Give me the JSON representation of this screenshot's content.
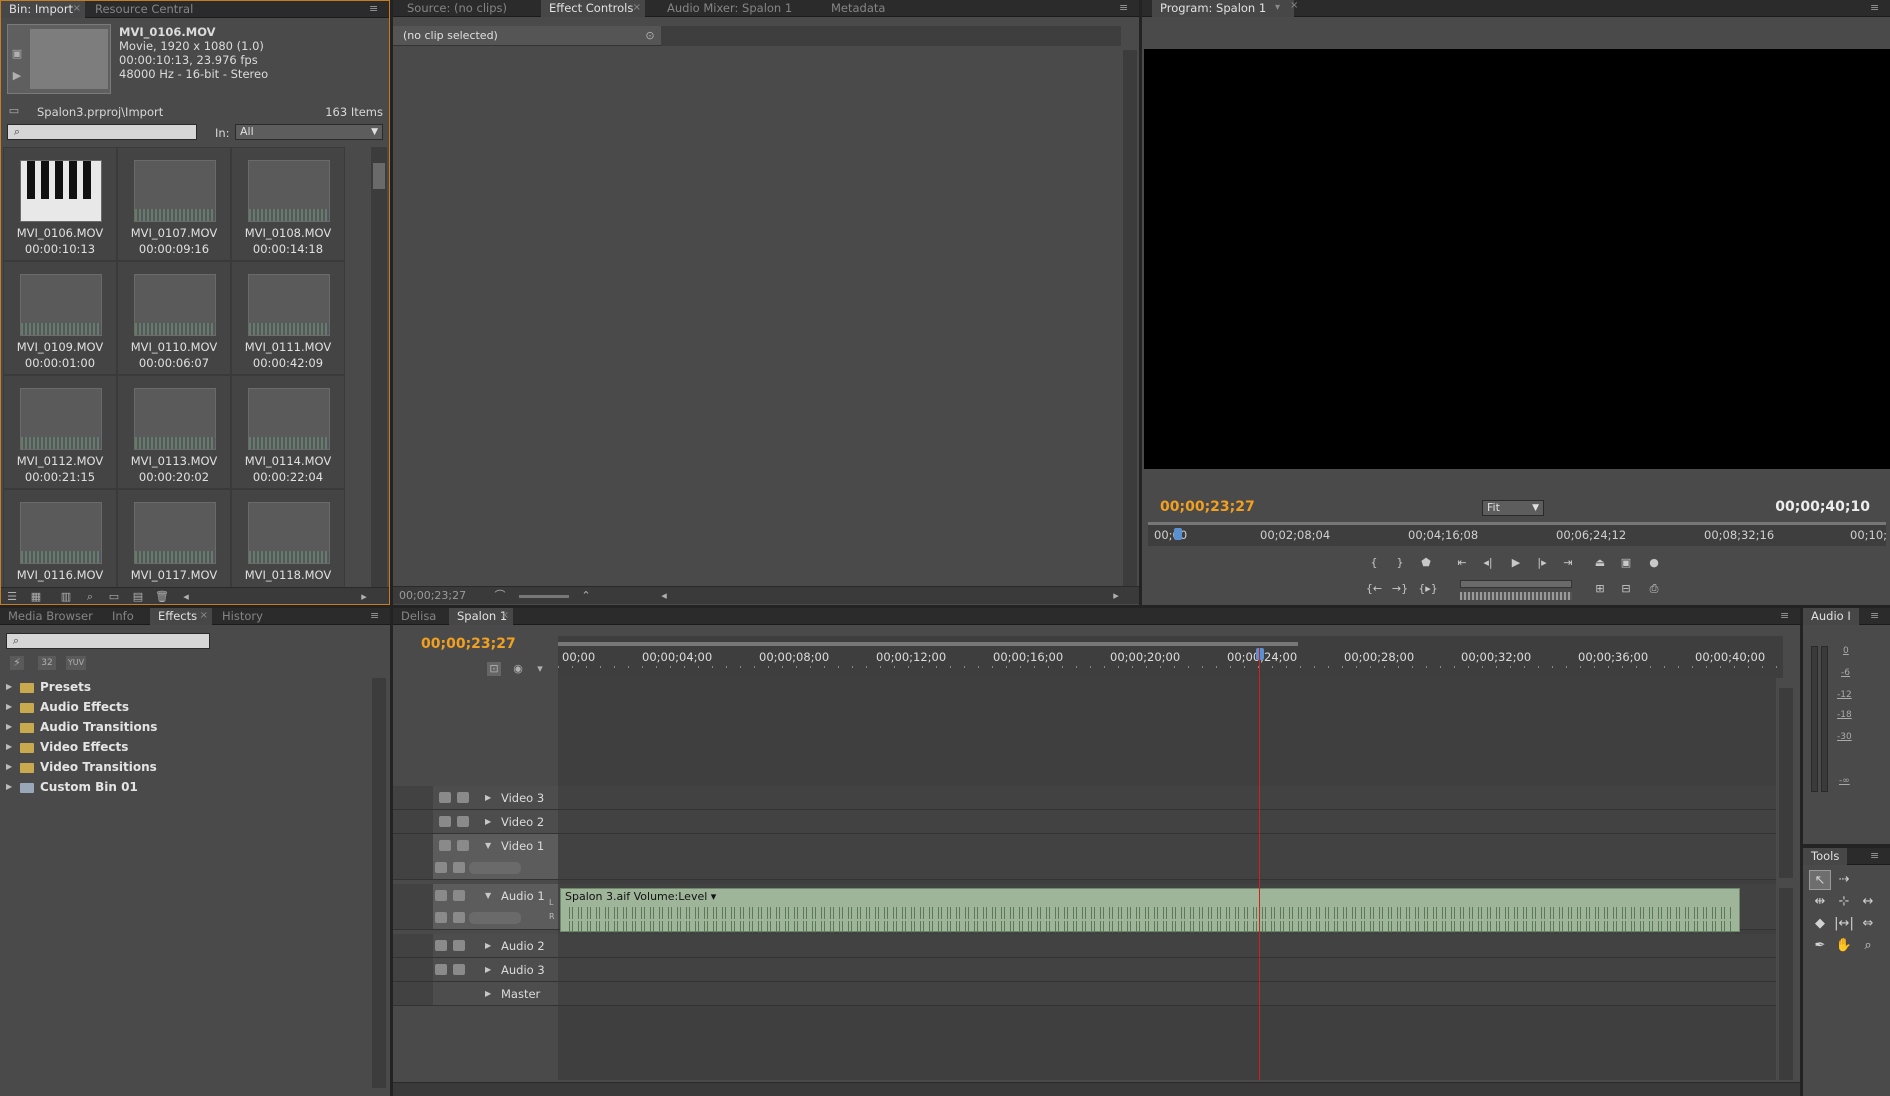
{
  "project": {
    "tabs": [
      "Bin: Import",
      "Resource Central"
    ],
    "clip": {
      "name": "MVI_0106.MOV",
      "line1": "Movie, 1920 x 1080 (1.0)",
      "line2": "00:00:10:13, 23.976 fps",
      "line3": "48000 Hz - 16-bit - Stereo"
    },
    "path": "Spalon3.prproj\\Import",
    "item_count": "163 Items",
    "in_label": "In:",
    "in_value": "All",
    "items": [
      {
        "name": "MVI_0106.MOV",
        "duration": "00:00:10:13"
      },
      {
        "name": "MVI_0107.MOV",
        "duration": "00:00:09:16"
      },
      {
        "name": "MVI_0108.MOV",
        "duration": "00:00:14:18"
      },
      {
        "name": "MVI_0109.MOV",
        "duration": "00:00:01:00"
      },
      {
        "name": "MVI_0110.MOV",
        "duration": "00:00:06:07"
      },
      {
        "name": "MVI_0111.MOV",
        "duration": "00:00:42:09"
      },
      {
        "name": "MVI_0112.MOV",
        "duration": "00:00:21:15"
      },
      {
        "name": "MVI_0113.MOV",
        "duration": "00:00:20:02"
      },
      {
        "name": "MVI_0114.MOV",
        "duration": "00:00:22:04"
      },
      {
        "name": "MVI_0116.MOV",
        "duration": ""
      },
      {
        "name": "MVI_0117.MOV",
        "duration": ""
      },
      {
        "name": "MVI_0118.MOV",
        "duration": ""
      }
    ]
  },
  "effect_controls": {
    "tabs": [
      "Source: (no clips)",
      "Effect Controls",
      "Audio Mixer: Spalon 1",
      "Metadata"
    ],
    "no_clip": "(no clip selected)",
    "timecode": "00;00;23;27"
  },
  "program": {
    "tab": "Program: Spalon 1",
    "current_tc": "00;00;23;27",
    "duration_tc": "00;00;40;10",
    "zoom": "Fit",
    "ruler": [
      "00;00",
      "00;02;08;04",
      "00;04;16;08",
      "00;06;24;12",
      "00;08;32;16",
      "00;10;"
    ]
  },
  "effects_panel": {
    "tabs": [
      "Media Browser",
      "Info",
      "Effects",
      "History"
    ],
    "folders": [
      "Presets",
      "Audio Effects",
      "Audio Transitions",
      "Video Effects",
      "Video Transitions",
      "Custom Bin 01"
    ],
    "icon_labels": [
      "32",
      "YUV"
    ]
  },
  "timeline": {
    "tabs": [
      "Delisa",
      "Spalon 1"
    ],
    "timecode": "00;00;23;27",
    "ruler": [
      "00;00",
      "00;00;04;00",
      "00;00;08;00",
      "00;00;12;00",
      "00;00;16;00",
      "00;00;20;00",
      "00;00;24;00",
      "00;00;28;00",
      "00;00;32;00",
      "00;00;36;00",
      "00;00;40;00"
    ],
    "tracks": {
      "video3": "Video 3",
      "video2": "Video 2",
      "video1": "Video 1",
      "audio1": "Audio 1",
      "audio2": "Audio 2",
      "audio3": "Audio 3",
      "master": "Master"
    },
    "clip_label": "Spalon 3.aif",
    "clip_effect": "Volume:Level",
    "lr": [
      "L",
      "R"
    ]
  },
  "audio_meter": {
    "tab": "Audio I",
    "labels": [
      "0",
      "-6",
      "-12",
      "-18",
      "-30",
      "-∞"
    ]
  },
  "tools": {
    "tab": "Tools"
  }
}
